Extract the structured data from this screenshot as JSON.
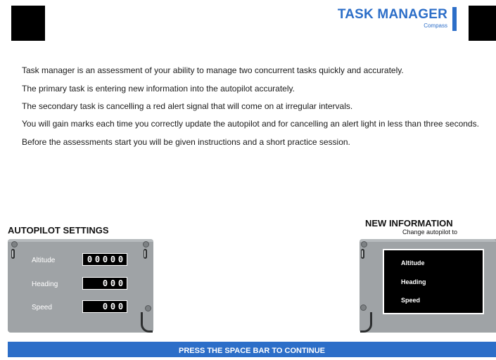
{
  "header": {
    "title": "TASK MANAGER",
    "subtitle": "Compass"
  },
  "intro": {
    "paragraphs": [
      "Task manager is an assessment of your ability to manage two concurrent tasks quickly and accurately.",
      "The primary task is entering new information into the autopilot accurately.",
      "The secondary task is cancelling a red alert signal that will come on at irregular intervals.",
      "You will gain marks each time you correctly update the autopilot and for cancelling an alert light in less than three seconds.",
      "Before the assessments start you will be given instructions and a short practice session."
    ]
  },
  "autopilot": {
    "title": "AUTOPILOT SETTINGS",
    "rows": [
      {
        "label": "Altitude",
        "digits": [
          "0",
          "0",
          "0",
          "0",
          "0"
        ]
      },
      {
        "label": "Heading",
        "digits": [
          "0",
          "0",
          "0"
        ]
      },
      {
        "label": "Speed",
        "digits": [
          "0",
          "0",
          "0"
        ]
      }
    ]
  },
  "new_info": {
    "title": "NEW INFORMATION",
    "subtitle": "Change autopilot to",
    "labels": [
      "Altitude",
      "Heading",
      "Speed"
    ]
  },
  "footer": {
    "text": "PRESS THE SPACE BAR TO CONTINUE"
  },
  "colors": {
    "accent": "#2c6ec8",
    "panel": "#9fa3a6",
    "display": "#000000"
  }
}
